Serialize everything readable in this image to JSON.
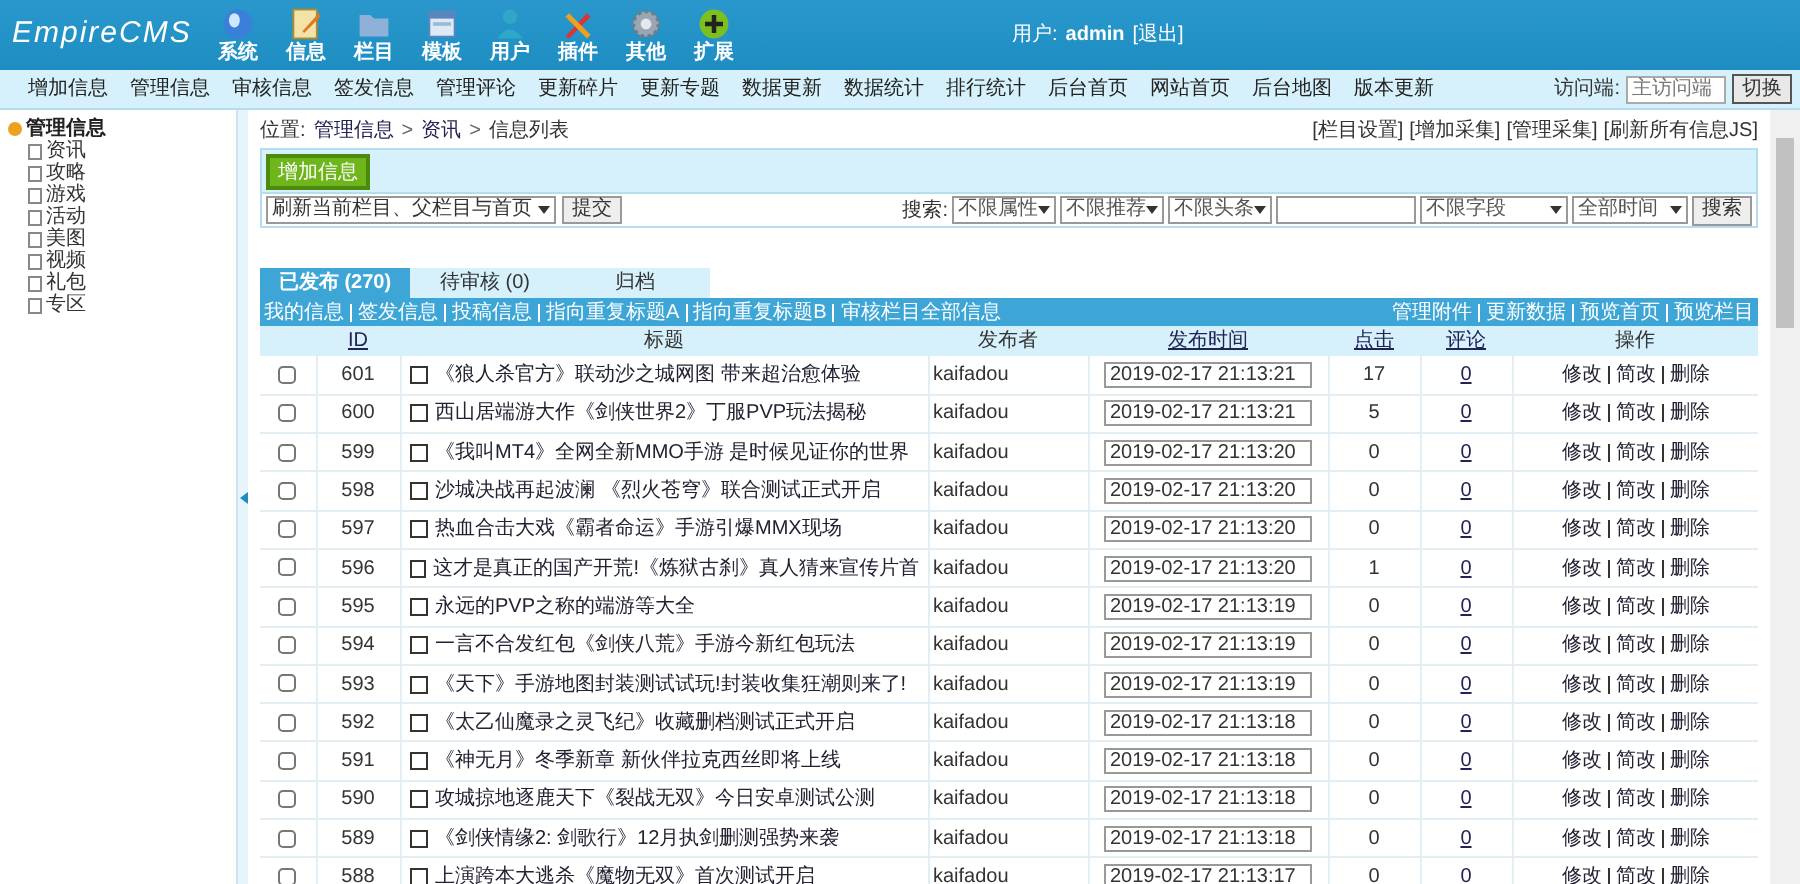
{
  "header": {
    "logo": "EmpireCMS",
    "menu": [
      {
        "label": "系统"
      },
      {
        "label": "信息"
      },
      {
        "label": "栏目"
      },
      {
        "label": "模板"
      },
      {
        "label": "用户"
      },
      {
        "label": "插件"
      },
      {
        "label": "其他"
      },
      {
        "label": "扩展"
      }
    ],
    "user_label": "用户:",
    "user": "admin",
    "logout": "[退出]"
  },
  "nav": {
    "items": [
      "增加信息",
      "管理信息",
      "审核信息",
      "签发信息",
      "管理评论",
      "更新碎片",
      "更新专题",
      "数据更新",
      "数据统计",
      "排行统计",
      "后台首页",
      "网站首页",
      "后台地图",
      "版本更新"
    ],
    "access_label": "访问端:",
    "access_value": "主访问端",
    "switch_button": "切换"
  },
  "sidebar": {
    "tree": [
      {
        "label": "管理信息",
        "expanded": true,
        "children": [
          {
            "label": "资讯"
          },
          {
            "label": "攻略"
          },
          {
            "label": "游戏"
          },
          {
            "label": "活动"
          },
          {
            "label": "美图"
          },
          {
            "label": "视频"
          },
          {
            "label": "礼包"
          },
          {
            "label": "专区"
          }
        ]
      }
    ]
  },
  "breadcrumb": {
    "label": "位置:",
    "path": [
      "管理信息",
      "资讯",
      "信息列表"
    ],
    "separators": [
      ">",
      ">"
    ]
  },
  "top_links": [
    "[栏目设置]",
    "[增加采集]",
    "[管理采集]",
    "[刷新所有信息JS]"
  ],
  "add_button": "增加信息",
  "refresh": {
    "value": "刷新当前栏目、父栏目与首页",
    "button": "提交"
  },
  "search": {
    "label": "搜索:",
    "filters": [
      "不限属性",
      "不限推荐",
      "不限头条"
    ],
    "field_select": "不限字段",
    "time_select": "全部时间",
    "button": "搜索"
  },
  "tabs": [
    {
      "label": "已发布 (270)",
      "selected": true
    },
    {
      "label": "待审核 (0)",
      "selected": false
    },
    {
      "label": "归档",
      "selected": false
    }
  ],
  "links_left": [
    "我的信息",
    "签发信息",
    "投稿信息",
    "指向重复标题A",
    "指向重复标题B",
    "审核栏目全部信息"
  ],
  "links_right": [
    "管理附件",
    "更新数据",
    "预览首页",
    "预览栏目"
  ],
  "table": {
    "columns": [
      "ID",
      "标题",
      "发布者",
      "发布时间",
      "点击",
      "评论",
      "操作"
    ],
    "rows": [
      {
        "checked": false,
        "id": "601",
        "title": "《狼人杀官方》联动沙之城网图 带来超治愈体验",
        "publisher": "kaifadou",
        "time": "2019-02-17 21:13:21",
        "clicks": "17",
        "comments": "0",
        "actions": [
          "修改",
          "简改",
          "删除"
        ]
      },
      {
        "checked": false,
        "id": "600",
        "title": "西山居端游大作《剑侠世界2》丁服PVP玩法揭秘",
        "publisher": "kaifadou",
        "time": "2019-02-17 21:13:21",
        "clicks": "5",
        "comments": "0",
        "actions": [
          "修改",
          "简改",
          "删除"
        ]
      },
      {
        "checked": false,
        "id": "599",
        "title": "《我叫MT4》全网全新MMO手游 是时候见证你的世界",
        "publisher": "kaifadou",
        "time": "2019-02-17 21:13:20",
        "clicks": "0",
        "comments": "0",
        "actions": [
          "修改",
          "简改",
          "删除"
        ]
      },
      {
        "checked": false,
        "id": "598",
        "title": "沙城决战再起波澜 《烈火苍穹》联合测试正式开启",
        "publisher": "kaifadou",
        "time": "2019-02-17 21:13:20",
        "clicks": "0",
        "comments": "0",
        "actions": [
          "修改",
          "简改",
          "删除"
        ]
      },
      {
        "checked": false,
        "id": "597",
        "title": "热血合击大戏《霸者命运》手游引爆MMX现场",
        "publisher": "kaifadou",
        "time": "2019-02-17 21:13:20",
        "clicks": "0",
        "comments": "0",
        "actions": [
          "修改",
          "简改",
          "删除"
        ]
      },
      {
        "checked": false,
        "id": "596",
        "title": "这才是真正的国产开荒!《炼狱古刹》真人猜来宣传片首",
        "publisher": "kaifadou",
        "time": "2019-02-17 21:13:20",
        "clicks": "1",
        "comments": "0",
        "actions": [
          "修改",
          "简改",
          "删除"
        ]
      },
      {
        "checked": false,
        "id": "595",
        "title": "永远的PVP之称的端游等大全",
        "publisher": "kaifadou",
        "time": "2019-02-17 21:13:19",
        "clicks": "0",
        "comments": "0",
        "actions": [
          "修改",
          "简改",
          "删除"
        ]
      },
      {
        "checked": false,
        "id": "594",
        "title": "一言不合发红包《剑侠八荒》手游今新红包玩法",
        "publisher": "kaifadou",
        "time": "2019-02-17 21:13:19",
        "clicks": "0",
        "comments": "0",
        "actions": [
          "修改",
          "简改",
          "删除"
        ]
      },
      {
        "checked": false,
        "id": "593",
        "title": "《天下》手游地图封装测试试玩!封装收集狂潮则来了!",
        "publisher": "kaifadou",
        "time": "2019-02-17 21:13:19",
        "clicks": "0",
        "comments": "0",
        "actions": [
          "修改",
          "简改",
          "删除"
        ]
      },
      {
        "checked": false,
        "id": "592",
        "title": "《太乙仙魔录之灵飞纪》收藏删档测试正式开启",
        "publisher": "kaifadou",
        "time": "2019-02-17 21:13:18",
        "clicks": "0",
        "comments": "0",
        "actions": [
          "修改",
          "简改",
          "删除"
        ]
      },
      {
        "checked": false,
        "id": "591",
        "title": "《神无月》冬季新章 新伙伴拉克西丝即将上线",
        "publisher": "kaifadou",
        "time": "2019-02-17 21:13:18",
        "clicks": "0",
        "comments": "0",
        "actions": [
          "修改",
          "简改",
          "删除"
        ]
      },
      {
        "checked": false,
        "id": "590",
        "title": "攻城掠地逐鹿天下《裂战无双》今日安卓测试公测",
        "publisher": "kaifadou",
        "time": "2019-02-17 21:13:18",
        "clicks": "0",
        "comments": "0",
        "actions": [
          "修改",
          "简改",
          "删除"
        ]
      },
      {
        "checked": false,
        "id": "589",
        "title": "《剑侠情缘2: 剑歌行》12月执剑删测强势来袭",
        "publisher": "kaifadou",
        "time": "2019-02-17 21:13:18",
        "clicks": "0",
        "comments": "0",
        "actions": [
          "修改",
          "简改",
          "删除"
        ]
      },
      {
        "checked": false,
        "id": "588",
        "title": "上演跨本大逃杀《魔物无双》首次测试开启",
        "publisher": "kaifadou",
        "time": "2019-02-17 21:13:17",
        "clicks": "0",
        "comments": "0",
        "actions": [
          "修改",
          "简改",
          "删除"
        ]
      }
    ]
  }
}
